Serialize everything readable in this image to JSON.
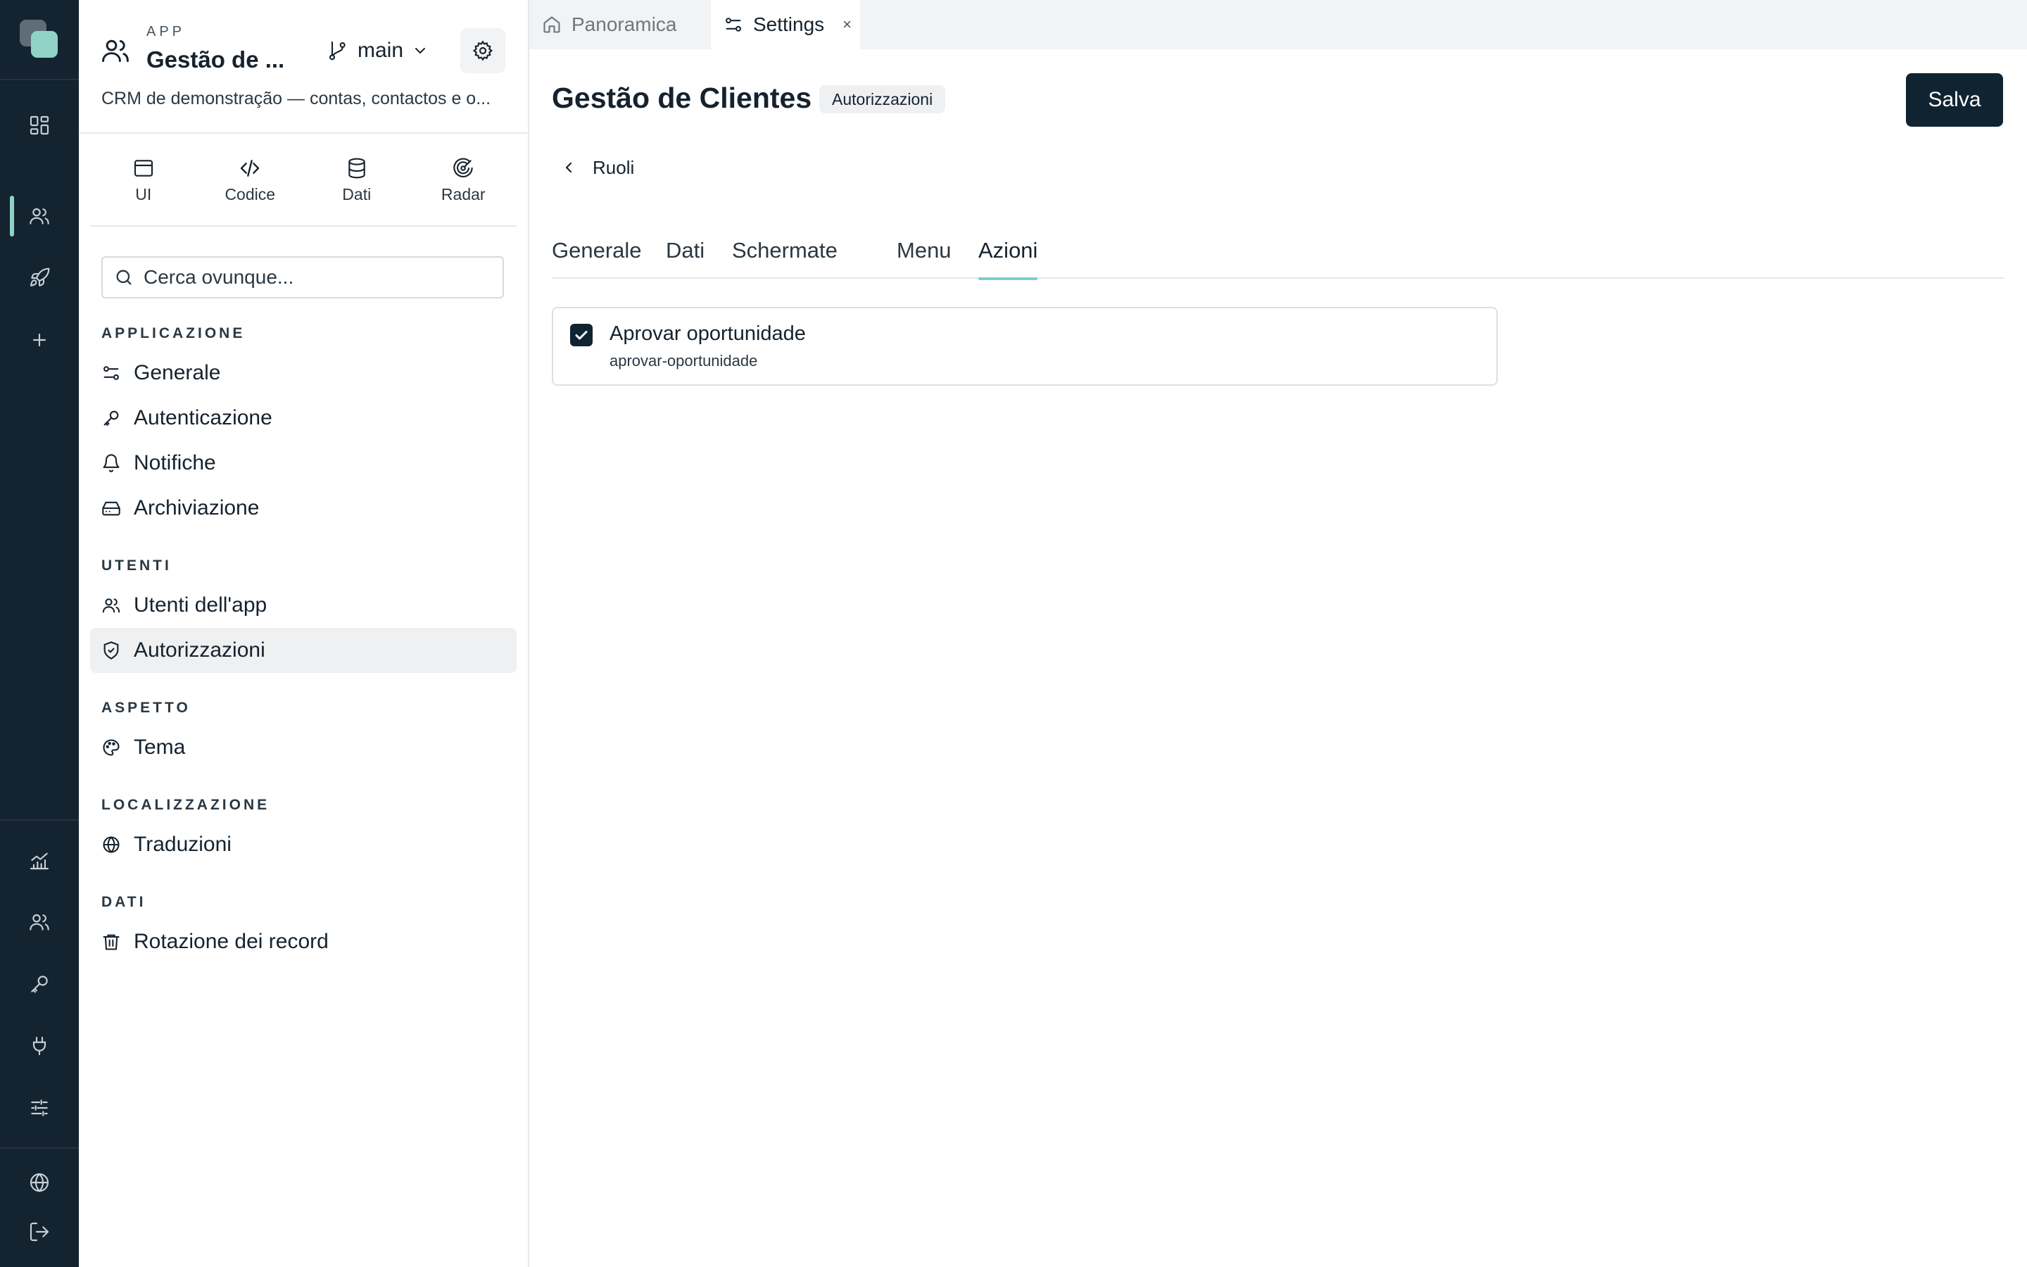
{
  "colors": {
    "rail_bg": "#142330",
    "accent": "#8fd3c6",
    "primary_button": "#102330",
    "text": "#16222d"
  },
  "rail": {
    "top_items": [
      {
        "icon": "dashboard-icon"
      },
      {
        "icon": "users-icon",
        "active": true
      },
      {
        "icon": "rocket-icon"
      },
      {
        "icon": "plus-icon"
      }
    ],
    "bottom_items": [
      {
        "icon": "analytics-icon"
      },
      {
        "icon": "team-icon"
      },
      {
        "icon": "key-icon"
      },
      {
        "icon": "plug-icon"
      },
      {
        "icon": "sliders-icon"
      },
      {
        "icon": "globe-icon"
      },
      {
        "icon": "logout-icon"
      }
    ]
  },
  "app": {
    "kicker": "APP",
    "title": "Gestão de ...",
    "branch": "main",
    "description": "CRM de demonstração — contas, contactos e o..."
  },
  "modes": [
    {
      "label": "UI",
      "icon": "window-icon"
    },
    {
      "label": "Codice",
      "icon": "code-icon"
    },
    {
      "label": "Dati",
      "icon": "database-icon"
    },
    {
      "label": "Radar",
      "icon": "radar-icon"
    }
  ],
  "search": {
    "placeholder": "Cerca ovunque..."
  },
  "sections": {
    "applicazione": {
      "title": "APPLICAZIONE",
      "items": [
        "Generale",
        "Autenticazione",
        "Notifiche",
        "Archiviazione"
      ]
    },
    "utenti": {
      "title": "UTENTI",
      "items": [
        "Utenti dell'app",
        "Autorizzazioni"
      ]
    },
    "aspetto": {
      "title": "ASPETTO",
      "items": [
        "Tema"
      ]
    },
    "localizzazione": {
      "title": "LOCALIZZAZIONE",
      "items": [
        "Traduzioni"
      ]
    },
    "dati": {
      "title": "DATI",
      "items": [
        "Rotazione dei record"
      ]
    }
  },
  "window_tabs": [
    {
      "label": "Panoramica",
      "icon": "home-icon"
    },
    {
      "label": "Settings",
      "icon": "settings-sliders-icon",
      "active": true,
      "close": "×"
    }
  ],
  "page": {
    "title": "Gestão de Clientes",
    "badge": "Autorizzazioni",
    "save_label": "Salva",
    "back_label": "Ruoli",
    "tabs": [
      "Generale",
      "Dati",
      "Schermate",
      "Menu",
      "Azioni"
    ],
    "active_tab": "Azioni"
  },
  "actions": [
    {
      "title": "Aprovar oportunidade",
      "slug": "aprovar-oportunidade",
      "checked": true
    }
  ]
}
